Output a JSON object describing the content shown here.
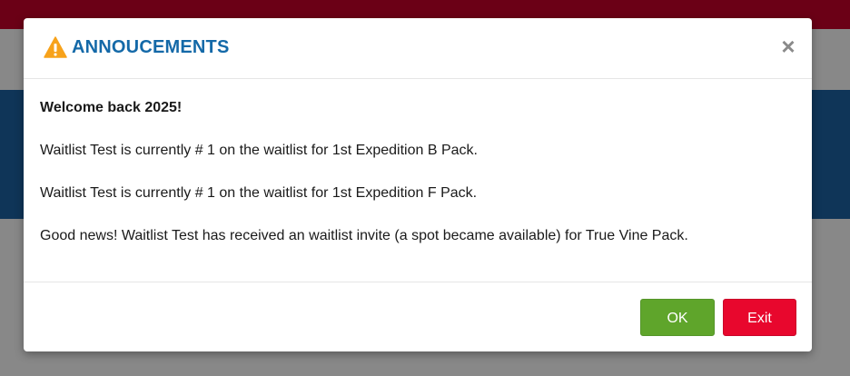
{
  "modal": {
    "title": "ANNOUCEMENTS",
    "close_symbol": "×",
    "icon": "warning-triangle-icon",
    "welcome": "Welcome back 2025!",
    "messages": [
      "Waitlist Test is currently # 1 on the waitlist for 1st Expedition B Pack.",
      "Waitlist Test is currently # 1 on the waitlist for 1st Expedition F Pack.",
      "Good news! Waitlist Test has received an waitlist invite (a spot became available) for True Vine Pack."
    ],
    "buttons": {
      "ok_label": "OK",
      "exit_label": "Exit"
    }
  },
  "colors": {
    "title": "#1469a8",
    "warning_icon": "#f7a21b",
    "ok_button": "#5fa52b",
    "exit_button": "#e8072d",
    "backdrop_band_top": "#6b0016",
    "backdrop_band_mid": "#0f3558"
  }
}
